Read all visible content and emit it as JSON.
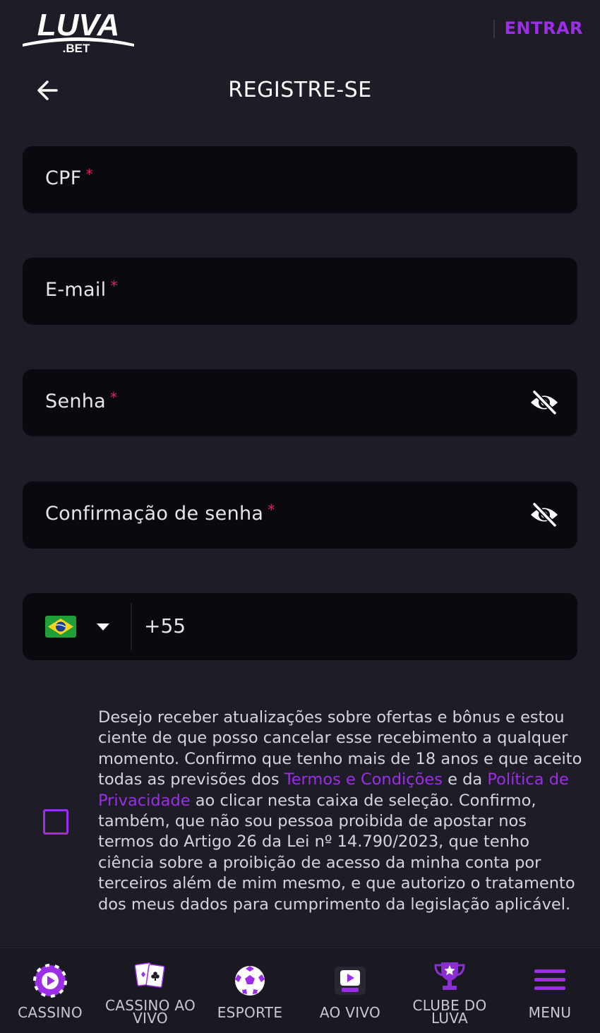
{
  "header": {
    "logo_text": "LUVA",
    "logo_sub": ".BET",
    "login_label": "ENTRAR"
  },
  "title": "REGISTRE-SE",
  "form": {
    "cpf_label": "CPF",
    "email_label": "E-mail",
    "password_label": "Senha",
    "password_confirm_label": "Confirmação de senha",
    "required_mark": "*",
    "phone_code": "+55"
  },
  "consent": {
    "checked": false,
    "text_1": "Desejo receber atualizações sobre ofertas e bônus e estou ciente de que posso cancelar esse recebimento a qualquer momento. Confirmo que tenho mais de 18 anos e que aceito todas as previsões dos ",
    "terms_link": "Termos e Condições",
    "text_2": " e da ",
    "privacy_link": "Política de Privacidade",
    "text_3": " ao clicar nesta caixa de seleção. Confirmo, também, que não sou pessoa proibida de apostar nos termos do Artigo 26 da Lei nº 14.790/2023, que tenho ciência sobre a proibição de acesso da minha conta por terceiros além de mim mesmo, e que autorizo o tratamento dos meus dados para cumprimento da legislação aplicável."
  },
  "bottom_nav": {
    "casino": "CASSINO",
    "live_casino_1": "CASSINO AO",
    "live_casino_2": "VIVO",
    "sport": "ESPORTE",
    "live": "AO VIVO",
    "club_1": "CLUBE DO",
    "club_2": "LUVA",
    "menu": "MENU"
  },
  "colors": {
    "background": "#1e1c26",
    "field_bg": "#0a0910",
    "accent": "#9b2ee6",
    "required": "#e0245e"
  }
}
